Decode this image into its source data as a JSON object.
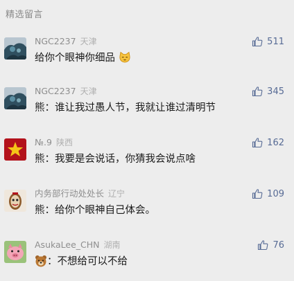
{
  "section_title": "精选留言",
  "comments": [
    {
      "nickname": "NGC2237",
      "location": "天津",
      "likes": "511",
      "content": "给你个眼神你细品",
      "content_emoji": "cat-emoji"
    },
    {
      "nickname": "NGC2237",
      "location": "天津",
      "likes": "345",
      "content": "熊：谁让我过愚人节，我就让谁过清明节"
    },
    {
      "nickname": "№.9",
      "location": "陕西",
      "likes": "162",
      "content": "熊：我要是会说话，你猜我会说点啥"
    },
    {
      "nickname": "内务部行动处处长",
      "location": "辽宁",
      "likes": "109",
      "content": "熊：给你个眼神自己体会。"
    },
    {
      "nickname": "AsukaLee_CHN",
      "location": "湖南",
      "likes": "76",
      "content_emoji": "bear-emoji",
      "content": "：不想给可以不给"
    }
  ],
  "colors": {
    "background": "#ededed",
    "like_blue": "#576b95",
    "nickname_gray": "#8e8e8e"
  }
}
